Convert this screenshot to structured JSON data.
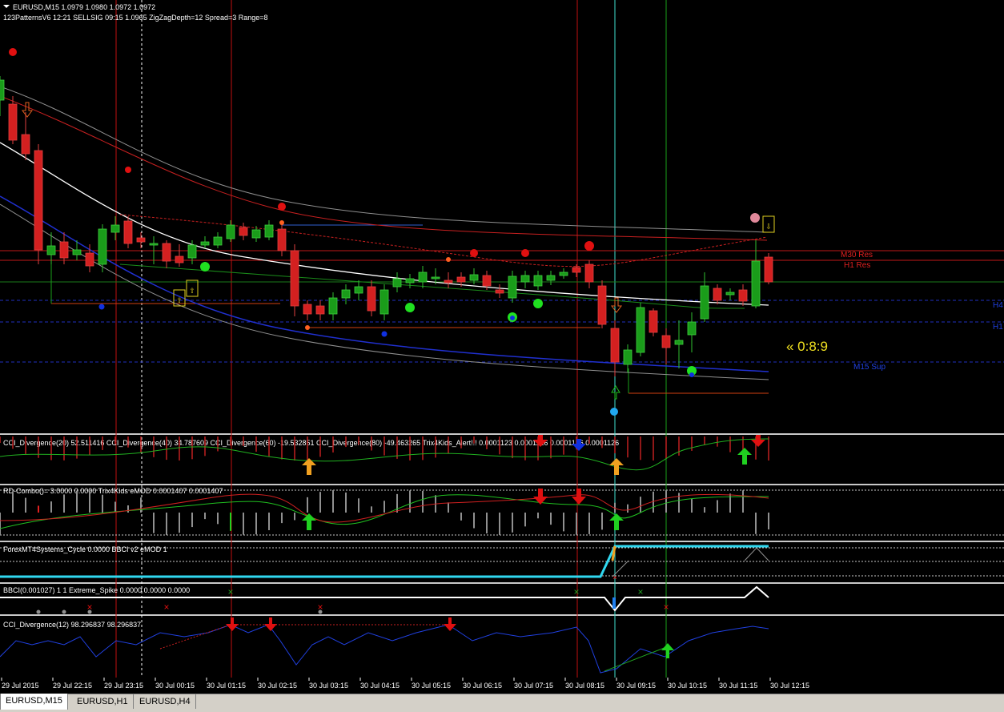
{
  "main": {
    "symbol_line": "EURUSD,M15  1.0979 1.0980 1.0972 1.0972",
    "pattern_line": "123PatternsV6  12:21  SELLSIG  09:15  1.0965  ZigZagDepth=12  Spread=3  Range=8",
    "timer": "« 0:8:9",
    "level_labels": {
      "m30_res": "M30 Res",
      "h1_res": "H1 Res",
      "h4": "H4",
      "h1": "H1",
      "m15_sup": "M15 Sup"
    }
  },
  "panes": {
    "cci_multi": "CCI_Divergence(20) 52.511416  CCI_Divergence(40) 34.787609  CCI_Divergence(60) -19.532851  CCI_Divergence(80) -49.463265  Trix4Kids_Alert!!! 0.0001123 0.0001126 0.0001126 0.0001126",
    "rd_combo": "RD-Combo()=  3.0000 0.0000  Trix4Kids eMOD 0.0001407 0.0001407",
    "cycle": "ForexMT4Systems_Cycle 0.0000  BBCI v2 eMOD 1",
    "bbci": "BBCI(0.001027) 1 1  Extreme_Spike 0.0000 0.0000 0.0000",
    "cci12": "CCI_Divergence(12) 98.296837 98.296837"
  },
  "time_axis": [
    "29 Jul 2015",
    "29 Jul 22:15",
    "29 Jul 23:15",
    "30 Jul 00:15",
    "30 Jul 01:15",
    "30 Jul 02:15",
    "30 Jul 03:15",
    "30 Jul 04:15",
    "30 Jul 05:15",
    "30 Jul 06:15",
    "30 Jul 07:15",
    "30 Jul 08:15",
    "30 Jul 09:15",
    "30 Jul 10:15",
    "30 Jul 11:15",
    "30 Jul 12:15"
  ],
  "tabs": [
    {
      "label": "EURUSD,M15",
      "active": true
    },
    {
      "label": "EURUSD,H1",
      "active": false
    },
    {
      "label": "EURUSD,H4",
      "active": false
    }
  ],
  "colors": {
    "background": "#000000",
    "bull": "#1a9c1a",
    "bear": "#d42020",
    "grid": "#ffffff"
  }
}
